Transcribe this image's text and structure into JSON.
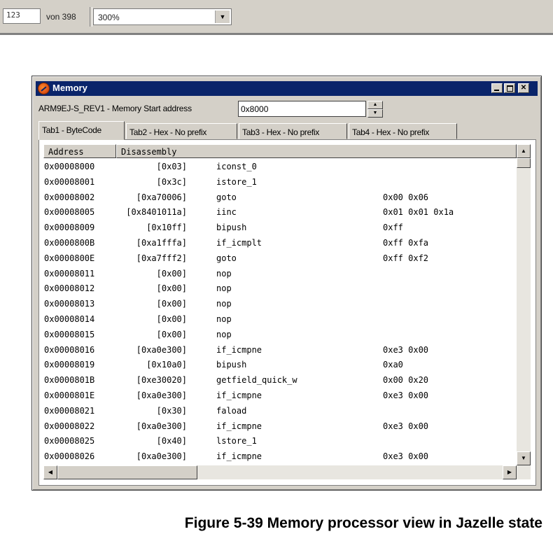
{
  "viewer": {
    "page_number": "123",
    "page_of": "von 398",
    "zoom": "300%"
  },
  "window": {
    "title": "Memory",
    "target_label": "ARM9EJ-S_REV1 - Memory   Start address",
    "start_address": "0x8000",
    "tabs": [
      {
        "label": "Tab1 - ByteCode",
        "active": true
      },
      {
        "label": "Tab2 - Hex - No prefix",
        "active": false
      },
      {
        "label": "Tab3 - Hex - No prefix",
        "active": false
      },
      {
        "label": "Tab4 - Hex - No prefix",
        "active": false
      }
    ],
    "columns": [
      "Address",
      "Disassembly"
    ],
    "rows": [
      {
        "addr": "0x00008000",
        "op": "[0x03]",
        "mn": "iconst_0",
        "args": ""
      },
      {
        "addr": "0x00008001",
        "op": "[0x3c]",
        "mn": "istore_1",
        "args": ""
      },
      {
        "addr": "0x00008002",
        "op": "[0xa70006]",
        "mn": "goto",
        "args": "0x00 0x06"
      },
      {
        "addr": "0x00008005",
        "op": "[0x8401011a]",
        "mn": "iinc",
        "args": "0x01 0x01 0x1a"
      },
      {
        "addr": "0x00008009",
        "op": "[0x10ff]",
        "mn": "bipush",
        "args": "0xff"
      },
      {
        "addr": "0x0000800B",
        "op": "[0xa1fffa]",
        "mn": "if_icmplt",
        "args": "0xff 0xfa"
      },
      {
        "addr": "0x0000800E",
        "op": "[0xa7fff2]",
        "mn": "goto",
        "args": "0xff 0xf2"
      },
      {
        "addr": "0x00008011",
        "op": "[0x00]",
        "mn": "nop",
        "args": ""
      },
      {
        "addr": "0x00008012",
        "op": "[0x00]",
        "mn": "nop",
        "args": ""
      },
      {
        "addr": "0x00008013",
        "op": "[0x00]",
        "mn": "nop",
        "args": ""
      },
      {
        "addr": "0x00008014",
        "op": "[0x00]",
        "mn": "nop",
        "args": ""
      },
      {
        "addr": "0x00008015",
        "op": "[0x00]",
        "mn": "nop",
        "args": ""
      },
      {
        "addr": "0x00008016",
        "op": "[0xa0e300]",
        "mn": "if_icmpne",
        "args": "0xe3 0x00"
      },
      {
        "addr": "0x00008019",
        "op": "[0x10a0]",
        "mn": "bipush",
        "args": "0xa0"
      },
      {
        "addr": "0x0000801B",
        "op": "[0xe30020]",
        "mn": "getfield_quick_w",
        "args": "0x00 0x20"
      },
      {
        "addr": "0x0000801E",
        "op": "[0xa0e300]",
        "mn": "if_icmpne",
        "args": "0xe3 0x00"
      },
      {
        "addr": "0x00008021",
        "op": "[0x30]",
        "mn": "faload",
        "args": ""
      },
      {
        "addr": "0x00008022",
        "op": "[0xa0e300]",
        "mn": "if_icmpne",
        "args": "0xe3 0x00"
      },
      {
        "addr": "0x00008025",
        "op": "[0x40]",
        "mn": "lstore_1",
        "args": ""
      },
      {
        "addr": "0x00008026",
        "op": "[0xa0e300]",
        "mn": "if_icmpne",
        "args": "0xe3 0x00"
      }
    ]
  },
  "caption": "Figure 5-39 Memory processor view in Jazelle state",
  "icons": {
    "app": "memory-window-icon",
    "minimize": "minimize-icon",
    "maximize": "maximize-icon",
    "close": "close-icon",
    "dropdown": "chevron-down-icon"
  }
}
